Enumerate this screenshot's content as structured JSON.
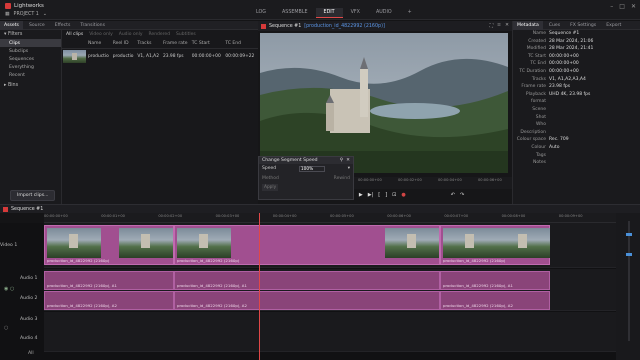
{
  "app": {
    "name": "Lightworks",
    "project": "PROJECT 1"
  },
  "modes": [
    {
      "label": "LOG",
      "active": false
    },
    {
      "label": "ASSEMBLE",
      "active": false
    },
    {
      "label": "EDIT",
      "active": true
    },
    {
      "label": "VFX",
      "active": false
    },
    {
      "label": "AUDIO",
      "active": false
    },
    {
      "label": "+",
      "active": false
    }
  ],
  "left_tabs": [
    "Assets",
    "Source",
    "Effects",
    "Transitions"
  ],
  "bins": {
    "filters_label": "Filters",
    "items": [
      "Clips",
      "Subclips",
      "Sequences",
      "Everything",
      "Recent"
    ],
    "bins_label": "Bins",
    "import_label": "Import clips..."
  },
  "clips_panel": {
    "tabs": [
      "All clips",
      "Video only",
      "Audio only",
      "Rendered",
      "Subtitles"
    ],
    "columns": [
      "Name",
      "Reel ID",
      "Tracks",
      "Frame rate",
      "TC Start",
      "TC End"
    ],
    "row": {
      "name": "productio",
      "reel": "productio",
      "tracks": "V1, A1,A2",
      "frame_rate": "23.98 fps",
      "tc_start": "00:00:00+00",
      "tc_end": "00:00:09+22"
    }
  },
  "viewer": {
    "title": "Sequence #1",
    "clip": "[production_id_4822992 (2160p)]",
    "ruler_ticks": [
      "00:00:00+00",
      "00:00:02+00",
      "00:00:04+00",
      "00:00:06+00"
    ]
  },
  "speed_dialog": {
    "title": "Change Segment Speed",
    "speed_label": "Speed",
    "speed_value": "100%",
    "method_label": "Method",
    "method_value": "Rewind",
    "apply_label": "Apply"
  },
  "metadata_tabs": [
    "Metadata",
    "Cues",
    "FX Settings",
    "Export"
  ],
  "metadata": [
    {
      "k": "Name",
      "v": "Sequence #1"
    },
    {
      "k": "Created",
      "v": "28 Mar 2024, 21:06"
    },
    {
      "k": "Modified",
      "v": "28 Mar 2024, 21:41"
    },
    {
      "k": "TC Start",
      "v": "00:00:00+00"
    },
    {
      "k": "TC End",
      "v": "00:00:00+00"
    },
    {
      "k": "TC Duration",
      "v": "00:00:00+00"
    },
    {
      "k": "Tracks",
      "v": "V1, A1,A2,A3,A4"
    },
    {
      "k": "Frame rate",
      "v": "23.98 fps"
    },
    {
      "k": "Playback format",
      "v": "UHD 4K, 23.98 fps"
    },
    {
      "k": "Scene",
      "v": ""
    },
    {
      "k": "Shot",
      "v": ""
    },
    {
      "k": "Who",
      "v": ""
    },
    {
      "k": "Description",
      "v": ""
    },
    {
      "k": "Colour space",
      "v": "Rec. 709"
    },
    {
      "k": "Colour",
      "v": "Auto"
    },
    {
      "k": "Tags",
      "v": ""
    },
    {
      "k": "Notes",
      "v": ""
    }
  ],
  "timeline": {
    "sequence": "Sequence #1",
    "ruler": [
      "00:00:00+00",
      "00:00:01+00",
      "00:00:02+00",
      "00:00:03+00",
      "00:00:04+00",
      "00:00:05+00",
      "00:00:06+00",
      "00:00:07+00",
      "00:00:08+00",
      "00:00:09+00",
      "00:00:10+00"
    ],
    "tracks": [
      "Video 1",
      "Audio 1",
      "Audio 2",
      "Audio 3",
      "Audio 4"
    ],
    "clip_label": "production_id_4822992 (2160p)",
    "audio_label_a1": "production_id_4822992 (2160p), A1",
    "audio_label_a2": "production_id_4822992 (2160p), A2",
    "zoom_label": "All"
  }
}
